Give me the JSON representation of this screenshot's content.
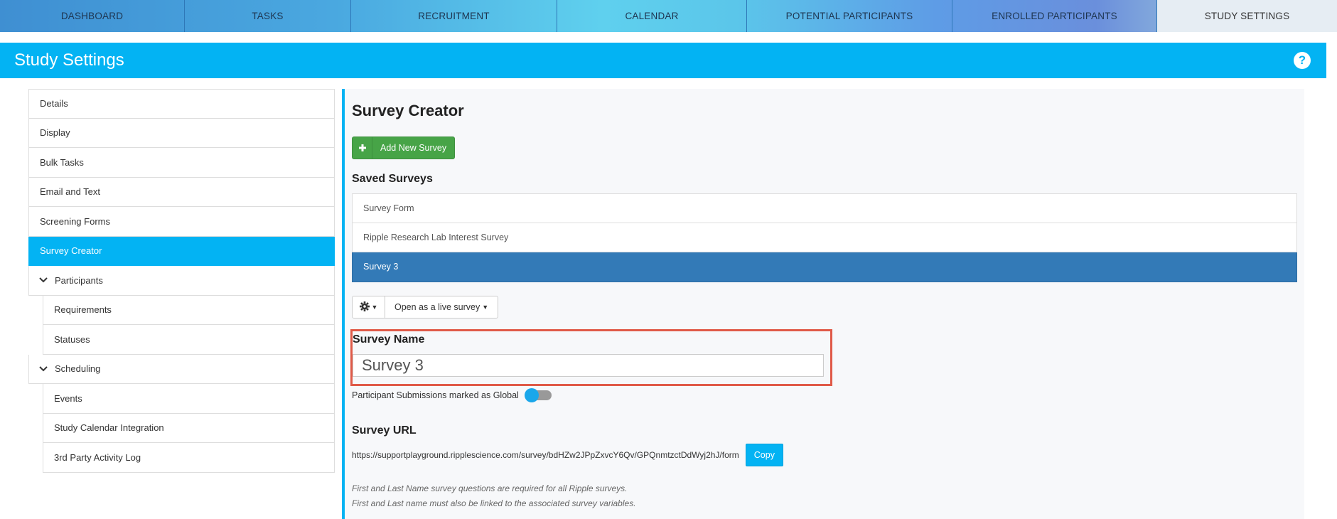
{
  "topnav": {
    "tabs": [
      {
        "label": "DASHBOARD"
      },
      {
        "label": "TASKS"
      },
      {
        "label": "RECRUITMENT"
      },
      {
        "label": "CALENDAR"
      },
      {
        "label": "POTENTIAL PARTICIPANTS"
      },
      {
        "label": "ENROLLED PARTICIPANTS"
      },
      {
        "label": "STUDY SETTINGS",
        "active": true
      }
    ]
  },
  "header": {
    "title": "Study Settings",
    "help_icon": "?"
  },
  "sidebar": {
    "items": [
      {
        "label": "Details"
      },
      {
        "label": "Display"
      },
      {
        "label": "Bulk Tasks"
      },
      {
        "label": "Email and Text"
      },
      {
        "label": "Screening Forms"
      },
      {
        "label": "Survey Creator",
        "active": true
      },
      {
        "label": "Participants",
        "group": true
      },
      {
        "label": "Requirements",
        "sub": true
      },
      {
        "label": "Statuses",
        "sub": true
      },
      {
        "label": "Scheduling",
        "group": true
      },
      {
        "label": "Events",
        "sub": true
      },
      {
        "label": "Study Calendar Integration",
        "sub": true
      },
      {
        "label": "3rd Party Activity Log",
        "sub": true
      }
    ]
  },
  "main": {
    "title": "Survey Creator",
    "add_button_label": "Add New Survey",
    "saved_heading": "Saved Surveys",
    "surveys": [
      {
        "label": "Survey Form"
      },
      {
        "label": "Ripple Research Lab Interest Survey"
      },
      {
        "label": "Survey 3",
        "active": true
      }
    ],
    "live_button_label": "Open as a live survey",
    "survey_name_label": "Survey Name",
    "survey_name_value": "Survey 3",
    "global_label": "Participant Submissions marked as Global",
    "global_toggle_on": false,
    "url_heading": "Survey URL",
    "url_value": "https://supportplayground.ripplescience.com/survey/bdHZw2JPpZxvcY6Qv/GPQnmtzctDdWyj2hJ/form",
    "copy_label": "Copy",
    "note_1": "First and Last Name survey questions are required for all Ripple surveys.",
    "note_2": "First and Last name must also be linked to the associated survey variables."
  },
  "colors": {
    "accent": "#03b3f3",
    "selected_survey": "#337ab7",
    "add_button": "#47a447",
    "highlight_border": "#e05a48"
  }
}
